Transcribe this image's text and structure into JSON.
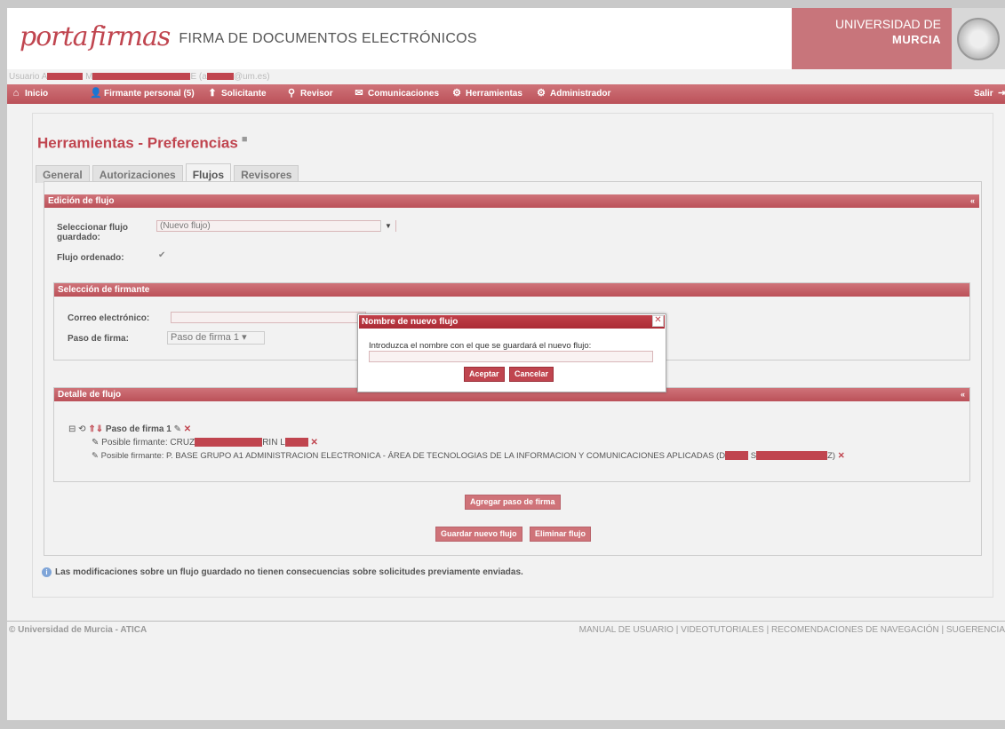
{
  "header": {
    "logo_part1": "porta",
    "logo_part2": "firmas",
    "subtitle": "FIRMA DE DOCUMENTOS ELECTRÓNICOS",
    "university_line1": "UNIVERSIDAD DE",
    "university_line2": "MURCIA",
    "user_prefix": "Usuario A",
    "user_middle": "M",
    "user_e": "E (a",
    "user_domain": "@um.es)"
  },
  "nav": {
    "inicio": "Inicio",
    "firmante": "Firmante personal (5)",
    "solicitante": "Solicitante",
    "revisor": "Revisor",
    "comunicaciones": "Comunicaciones",
    "herramientas": "Herramientas",
    "administrador": "Administrador",
    "salir": "Salir"
  },
  "page": {
    "title": "Herramientas - Preferencias",
    "tabs": [
      "General",
      "Autorizaciones",
      "Flujos",
      "Revisores"
    ]
  },
  "edicion": {
    "header": "Edición de flujo",
    "select_label_1": "Seleccionar flujo",
    "select_label_2": "guardado:",
    "select_value": "(Nuevo flujo)",
    "ordered_label": "Flujo ordenado:",
    "ordered_mark": "✔"
  },
  "seleccion": {
    "header": "Selección de firmante",
    "email_label": "Correo electrónico:",
    "paso_label": "Paso de firma:",
    "paso_value": "Paso de firma 1"
  },
  "detalle": {
    "header": "Detalle de flujo",
    "step_label": "Paso de firma 1",
    "signer1_prefix": "Posible firmante: CRUZ",
    "signer1_mid": "RIN L",
    "signer2_prefix": "Posible firmante: P. BASE GRUPO A1 ADMINISTRACION ELECTRONICA - ÁREA DE TECNOLOGIAS DE LA INFORMACION Y COMUNICACIONES APLICADAS (D",
    "signer2_mid": "S",
    "signer2_end": "Z)"
  },
  "buttons": {
    "agregar": "Agregar paso de firma",
    "guardar": "Guardar nuevo flujo",
    "eliminar": "Eliminar flujo"
  },
  "info_text": "Las modificaciones sobre un flujo guardado no tienen consecuencias sobre solicitudes previamente enviadas.",
  "dialog": {
    "title": "Nombre de nuevo flujo",
    "prompt": "Introduzca el nombre con el que se guardará el nuevo flujo:",
    "accept": "Aceptar",
    "cancel": "Cancelar"
  },
  "footer": {
    "left": "© Universidad de Murcia - ATICA",
    "right": "MANUAL DE USUARIO | VIDEOTUTORIALES | RECOMENDACIONES DE NAVEGACIÓN | SUGERENCIA"
  },
  "colors": {
    "brand": "#c0454f",
    "brand_light": "#cf7379"
  }
}
